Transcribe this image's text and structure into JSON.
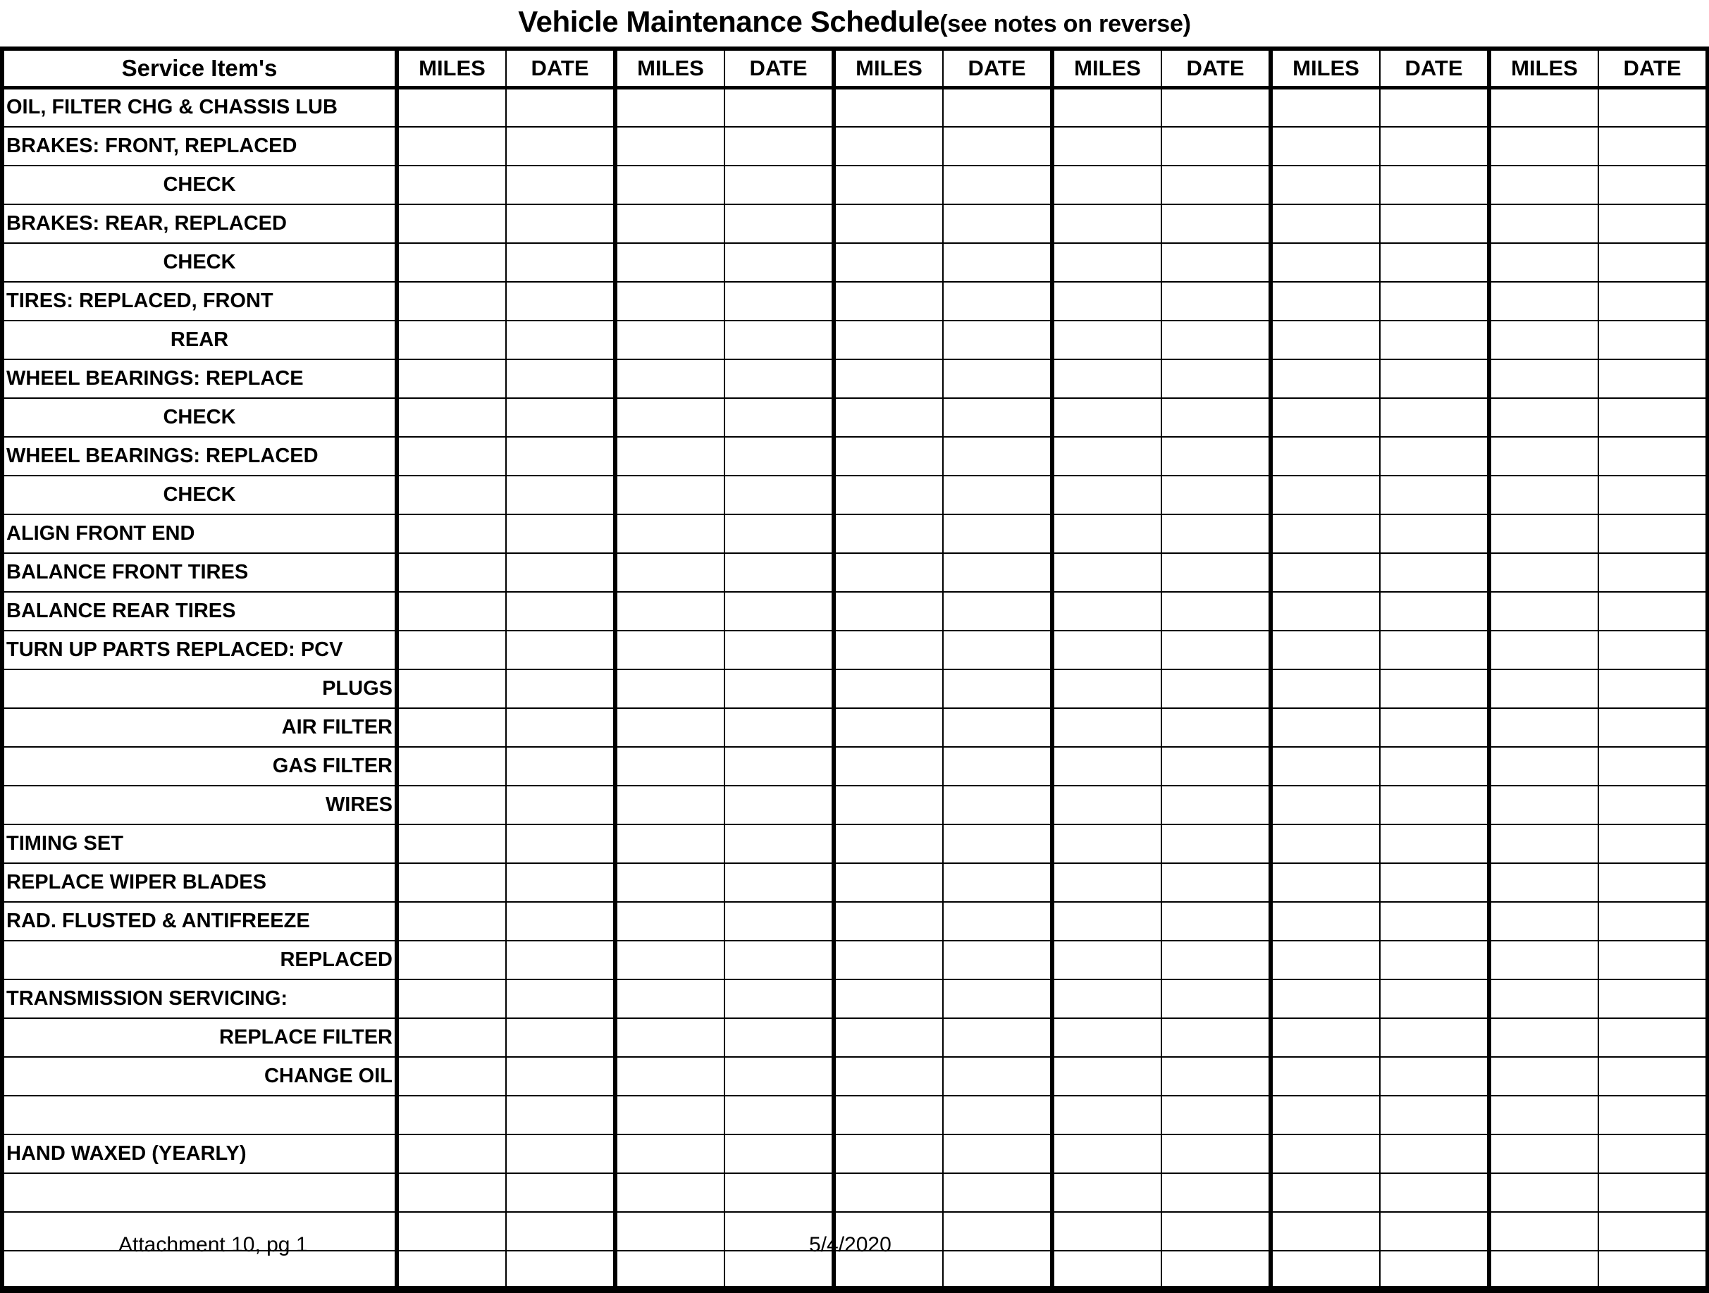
{
  "document": {
    "title_main": "Vehicle Maintenance Schedule",
    "title_note": "(see notes on reverse)"
  },
  "table": {
    "headers": {
      "service_item": "Service Item's",
      "miles": "MILES",
      "date": "DATE"
    },
    "column_group_count": 6,
    "rows": [
      {
        "label": "OIL, FILTER CHG & CHASSIS LUB",
        "align": "left"
      },
      {
        "label": "BRAKES:  FRONT, REPLACED",
        "align": "left"
      },
      {
        "label": "CHECK",
        "align": "center"
      },
      {
        "label": "BRAKES:  REAR, REPLACED",
        "align": "left"
      },
      {
        "label": "CHECK",
        "align": "center"
      },
      {
        "label": "TIRES:  REPLACED, FRONT",
        "align": "left"
      },
      {
        "label": "REAR",
        "align": "center"
      },
      {
        "label": "WHEEL BEARINGS: REPLACE",
        "align": "left"
      },
      {
        "label": "CHECK",
        "align": "center"
      },
      {
        "label": "WHEEL BEARINGS: REPLACED",
        "align": "left"
      },
      {
        "label": "CHECK",
        "align": "center"
      },
      {
        "label": "ALIGN FRONT END",
        "align": "left"
      },
      {
        "label": "BALANCE FRONT TIRES",
        "align": "left"
      },
      {
        "label": "BALANCE REAR TIRES",
        "align": "left"
      },
      {
        "label": "TURN UP PARTS REPLACED: PCV",
        "align": "left"
      },
      {
        "label": "PLUGS",
        "align": "right"
      },
      {
        "label": "AIR FILTER",
        "align": "right"
      },
      {
        "label": "GAS FILTER",
        "align": "right"
      },
      {
        "label": "WIRES",
        "align": "right"
      },
      {
        "label": "TIMING SET",
        "align": "left"
      },
      {
        "label": "REPLACE WIPER BLADES",
        "align": "left"
      },
      {
        "label": "RAD. FLUSTED & ANTIFREEZE",
        "align": "left"
      },
      {
        "label": "REPLACED",
        "align": "right"
      },
      {
        "label": "TRANSMISSION SERVICING:",
        "align": "left"
      },
      {
        "label": "REPLACE FILTER",
        "align": "right"
      },
      {
        "label": "CHANGE OIL",
        "align": "right"
      },
      {
        "label": "",
        "align": "left"
      },
      {
        "label": "HAND WAXED (YEARLY)",
        "align": "left"
      },
      {
        "label": "",
        "align": "left"
      },
      {
        "label": "",
        "align": "left"
      },
      {
        "label": "",
        "align": "left"
      }
    ]
  },
  "footer": {
    "attachment": "Attachment 10, pg 1",
    "date": "5/4/2020"
  }
}
